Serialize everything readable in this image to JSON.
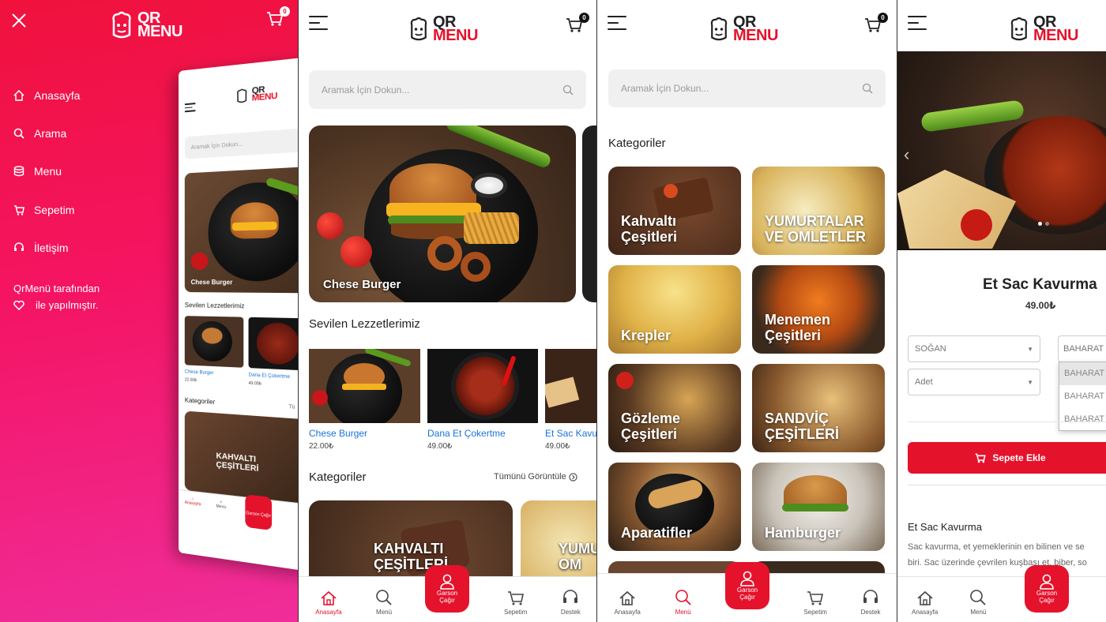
{
  "brand": {
    "qr": "QR",
    "menu": "MENU",
    "cart_count": "0"
  },
  "side_menu": {
    "items": [
      {
        "label": "Anasayfa",
        "icon": "home-icon"
      },
      {
        "label": "Arama",
        "icon": "search-icon"
      },
      {
        "label": "Menu",
        "icon": "database-icon"
      },
      {
        "label": "Sepetim",
        "icon": "cart-icon"
      },
      {
        "label": "İletişim",
        "icon": "headset-icon"
      }
    ],
    "credit_line1": "QrMenü tarafından",
    "credit_line2": "ile yapılmıştır."
  },
  "mini_preview": {
    "search_placeholder": "Aramak İçin Dokun...",
    "slide_label": "Chese Burger",
    "section_title": "Sevilen Lezzetlerimiz",
    "items": [
      {
        "name": "Chese Burger",
        "price": "22.00₺"
      },
      {
        "name": "Dana Et Çokertme",
        "price": "49.00₺"
      }
    ],
    "categories_title": "Kategoriler",
    "see_all": "Tü",
    "cat_label": "KAHVALTI ÇEŞİTLERİ",
    "nav": {
      "home": "Anasayfa",
      "menu": "Menü",
      "garson": "Garson Çağır"
    }
  },
  "home": {
    "search_placeholder": "Aramak İçin Dokun...",
    "slide_label": "Chese Burger",
    "favorites_title": "Sevilen Lezzetlerimiz",
    "favorites": [
      {
        "name": "Chese Burger",
        "price": "22.00₺"
      },
      {
        "name": "Dana Et Çokertme",
        "price": "49.00₺"
      },
      {
        "name": "Et Sac Kavu",
        "price": "49.00₺"
      }
    ],
    "categories_title": "Kategoriler",
    "see_all": "Tümünü Görüntüle",
    "categories": [
      "KAHVALTI ÇEŞİTLERİ",
      "YUMU OM"
    ]
  },
  "categories_page": {
    "search_placeholder": "Aramak İçin Dokun...",
    "title": "Kategoriler",
    "items": [
      "Kahvaltı Çeşitleri",
      "YUMURTALAR VE OMLETLER",
      "Krepler",
      "Menemen Çeşitleri",
      "Gözleme Çeşitleri",
      "SANDVİÇ ÇEŞİTLERİ",
      "Aparatifler",
      "Hamburger"
    ]
  },
  "product": {
    "name": "Et Sac Kavurma",
    "price": "49.00₺",
    "select1": "SOĞAN",
    "select2": "BAHARAT",
    "select3": "Adet",
    "dropdown_options": [
      "BAHARAT",
      "BAHARAT",
      "BAHARAT"
    ],
    "add_button": "Sepete Ekle",
    "desc_title": "Et Sac Kavurma",
    "desc_line1": "Sac kavurma, et yemeklerinin en bilinen ve se",
    "desc_line2": "biri. Sac üzerinde çevrilen kuşbaşı et, biber, so"
  },
  "nav": {
    "home": "Anasayfa",
    "menu": "Menü",
    "garson1": "Garson",
    "garson2": "Çağır",
    "cart": "Sepetim",
    "support": "Destek"
  },
  "colors": {
    "accent": "#e5122c",
    "gradient_top": "#f0123c",
    "gradient_bottom": "#f02d9a"
  }
}
